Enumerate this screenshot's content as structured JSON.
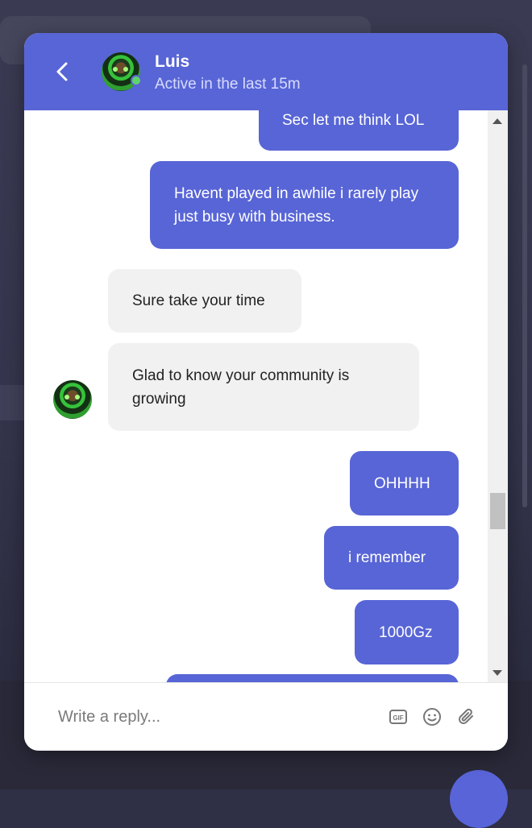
{
  "header": {
    "name": "Luis",
    "status": "Active in the last 15m"
  },
  "messages": [
    {
      "from": "me",
      "text": "Sec let me think LOL"
    },
    {
      "from": "me",
      "text": "Havent played in awhile i rarely play just busy with business."
    },
    {
      "from": "them",
      "text": "Sure take your time"
    },
    {
      "from": "them",
      "text": "Glad to know your community is growing"
    },
    {
      "from": "me",
      "text": "OHHHH"
    },
    {
      "from": "me",
      "text": "i remember"
    },
    {
      "from": "me",
      "text": "1000Gz"
    }
  ],
  "composer": {
    "placeholder": "Write a reply...",
    "gif_label": "GIF"
  },
  "colors": {
    "accent": "#5865d6",
    "incoming_bubble": "#f1f1f1",
    "online": "#5ed36a"
  },
  "icons": {
    "back": "chevron-left-icon",
    "gif": "gif-icon",
    "emoji": "smiley-icon",
    "attach": "paperclip-icon"
  }
}
